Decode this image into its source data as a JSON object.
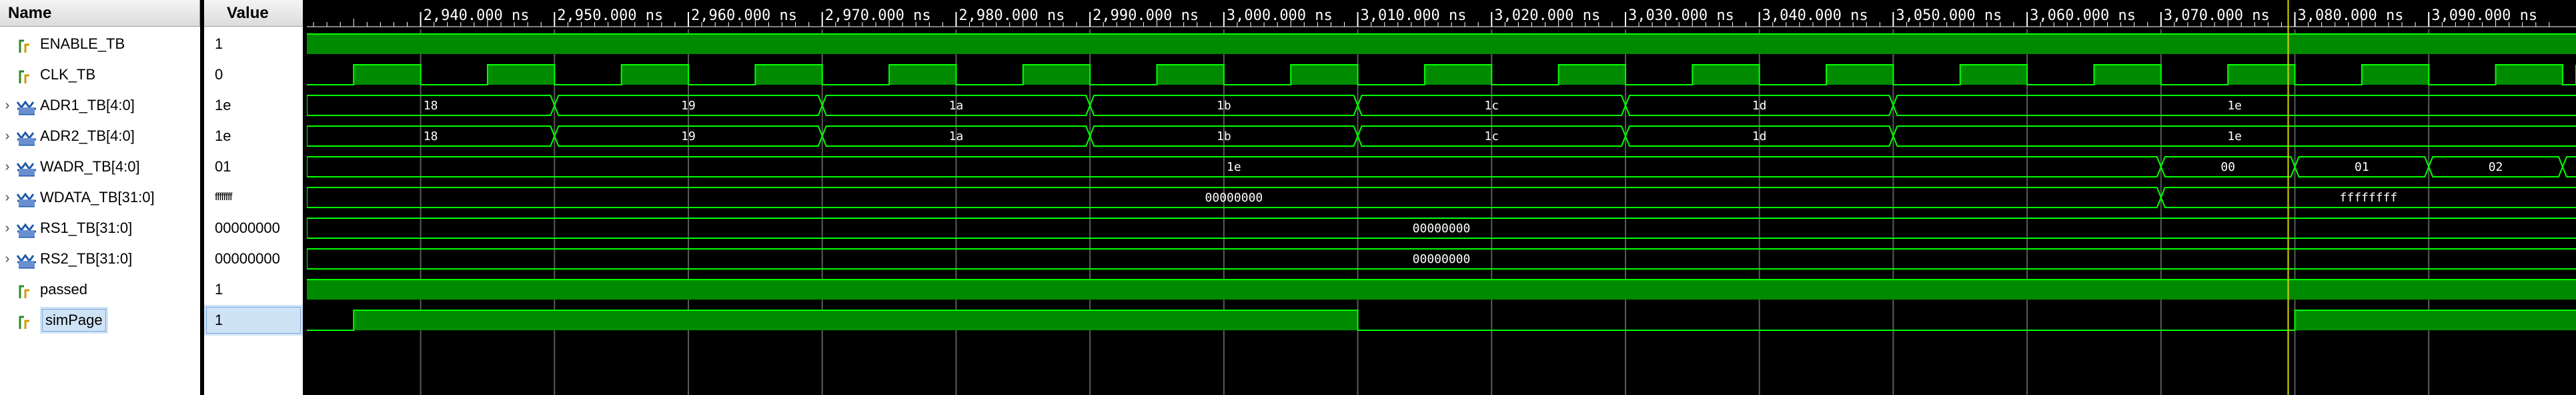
{
  "headers": {
    "name": "Name",
    "value": "Value"
  },
  "timeline": {
    "ticks": [
      {
        "t": 2940,
        "label": "2,940.000 ns"
      },
      {
        "t": 2950,
        "label": "2,950.000 ns"
      },
      {
        "t": 2960,
        "label": "2,960.000 ns"
      },
      {
        "t": 2970,
        "label": "2,970.000 ns"
      },
      {
        "t": 2980,
        "label": "2,980.000 ns"
      },
      {
        "t": 2990,
        "label": "2,990.000 ns"
      },
      {
        "t": 3000,
        "label": "3,000.000 ns"
      },
      {
        "t": 3010,
        "label": "3,010.000 ns"
      },
      {
        "t": 3020,
        "label": "3,020.000 ns"
      },
      {
        "t": 3030,
        "label": "3,030.000 ns"
      },
      {
        "t": 3040,
        "label": "3,040.000 ns"
      },
      {
        "t": 3050,
        "label": "3,050.000 ns"
      },
      {
        "t": 3060,
        "label": "3,060.000 ns"
      },
      {
        "t": 3070,
        "label": "3,070.000 ns"
      },
      {
        "t": 3080,
        "label": "3,080.000 ns"
      },
      {
        "t": 3090,
        "label": "3,090.000 ns"
      }
    ],
    "view_start_ns": 2931.5,
    "view_end_ns": 3101,
    "cursor_ns": 3079.5
  },
  "colors": {
    "wave": "#00ff00",
    "wave_fill": "#008a00",
    "bus_text": "#ffffff",
    "grid": "#5a5a5a",
    "cursor": "#d8d800",
    "ruler": "#ffffff"
  },
  "signals": [
    {
      "name": "ENABLE_TB",
      "value": "1",
      "icon": "scalar-signal-icon",
      "expandable": false,
      "type": "bit",
      "changes": [
        [
          2931.5,
          1
        ]
      ]
    },
    {
      "name": "CLK_TB",
      "value": "0",
      "icon": "scalar-signal-icon",
      "expandable": false,
      "type": "clock",
      "period": 10,
      "first_rise": 2935
    },
    {
      "name": "ADR1_TB[4:0]",
      "value": "1e",
      "icon": "bus-signal-icon",
      "expandable": true,
      "type": "bus",
      "segments": [
        {
          "s": 2931.5,
          "v": "18"
        },
        {
          "s": 2950,
          "v": "19"
        },
        {
          "s": 2970,
          "v": "1a"
        },
        {
          "s": 2990,
          "v": "1b"
        },
        {
          "s": 3010,
          "v": "1c"
        },
        {
          "s": 3030,
          "v": "1d"
        },
        {
          "s": 3050,
          "v": "1e"
        }
      ]
    },
    {
      "name": "ADR2_TB[4:0]",
      "value": "1e",
      "icon": "bus-signal-icon",
      "expandable": true,
      "type": "bus",
      "segments": [
        {
          "s": 2931.5,
          "v": "18"
        },
        {
          "s": 2950,
          "v": "19"
        },
        {
          "s": 2970,
          "v": "1a"
        },
        {
          "s": 2990,
          "v": "1b"
        },
        {
          "s": 3010,
          "v": "1c"
        },
        {
          "s": 3030,
          "v": "1d"
        },
        {
          "s": 3050,
          "v": "1e"
        }
      ]
    },
    {
      "name": "WADR_TB[4:0]",
      "value": "01",
      "icon": "bus-signal-icon",
      "expandable": true,
      "type": "bus",
      "segments": [
        {
          "s": 2931.5,
          "v": "1e"
        },
        {
          "s": 3070,
          "v": "00"
        },
        {
          "s": 3080,
          "v": "01"
        },
        {
          "s": 3090,
          "v": "02"
        },
        {
          "s": 3100,
          "v": ""
        }
      ]
    },
    {
      "name": "WDATA_TB[31:0]",
      "value": "ffffffff",
      "icon": "bus-signal-icon",
      "expandable": true,
      "type": "bus",
      "segments": [
        {
          "s": 2931.5,
          "v": "00000000"
        },
        {
          "s": 3070,
          "v": "ffffffff"
        }
      ]
    },
    {
      "name": "RS1_TB[31:0]",
      "value": "00000000",
      "icon": "bus-signal-icon",
      "expandable": true,
      "type": "bus",
      "segments": [
        {
          "s": 2931.5,
          "v": "00000000"
        }
      ]
    },
    {
      "name": "RS2_TB[31:0]",
      "value": "00000000",
      "icon": "bus-signal-icon",
      "expandable": true,
      "type": "bus",
      "segments": [
        {
          "s": 2931.5,
          "v": "00000000"
        }
      ]
    },
    {
      "name": "passed",
      "value": "1",
      "icon": "scalar-signal-icon",
      "expandable": false,
      "type": "bit",
      "changes": [
        [
          2931.5,
          1
        ]
      ]
    },
    {
      "name": "simPage",
      "value": "1",
      "icon": "scalar-signal-icon",
      "expandable": false,
      "type": "bit",
      "selected": true,
      "changes": [
        [
          2931.5,
          0
        ],
        [
          2935,
          1
        ],
        [
          3010,
          0
        ],
        [
          3080,
          1
        ]
      ]
    }
  ]
}
